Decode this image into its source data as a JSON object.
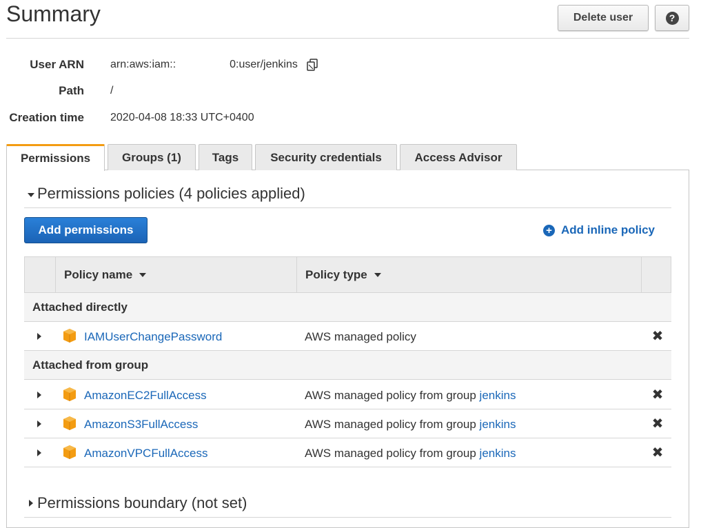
{
  "page": {
    "title": "Summary",
    "delete_user_label": "Delete user",
    "help_glyph": "?"
  },
  "summary": {
    "user_arn": {
      "label": "User ARN",
      "value_prefix": "arn:aws:iam::",
      "value_suffix": "0:user/jenkins"
    },
    "path": {
      "label": "Path",
      "value": "/"
    },
    "creation_time": {
      "label": "Creation time",
      "value": "2020-04-08 18:33 UTC+0400"
    }
  },
  "tabs": [
    {
      "label": "Permissions",
      "active": true
    },
    {
      "label": "Groups (1)",
      "active": false
    },
    {
      "label": "Tags",
      "active": false
    },
    {
      "label": "Security credentials",
      "active": false
    },
    {
      "label": "Access Advisor",
      "active": false
    }
  ],
  "permissions": {
    "section_title": "Permissions policies (4 policies applied)",
    "add_permissions_label": "Add permissions",
    "add_inline_label": "Add inline policy",
    "add_inline_glyph": "+",
    "columns": {
      "policy_name": "Policy name",
      "policy_type": "Policy type"
    },
    "groups": [
      {
        "label": "Attached directly",
        "rows": [
          {
            "name": "IAMUserChangePassword",
            "type": "AWS managed policy",
            "group_link": ""
          }
        ]
      },
      {
        "label": "Attached from group",
        "rows": [
          {
            "name": "AmazonEC2FullAccess",
            "type": "AWS managed policy from group ",
            "group_link": "jenkins"
          },
          {
            "name": "AmazonS3FullAccess",
            "type": "AWS managed policy from group ",
            "group_link": "jenkins"
          },
          {
            "name": "AmazonVPCFullAccess",
            "type": "AWS managed policy from group ",
            "group_link": "jenkins"
          }
        ]
      }
    ],
    "remove_glyph": "✖"
  },
  "boundary": {
    "section_title": "Permissions boundary (not set)"
  },
  "icons": {
    "copy": "copy-icon",
    "package": "package-icon",
    "expand": "caret-right-icon",
    "collapse": "caret-down-icon"
  },
  "colors": {
    "link": "#1a67b8",
    "primary_button": "#1b63b6",
    "active_tab_accent": "#f39c12",
    "package_icon": "#f39c12"
  }
}
